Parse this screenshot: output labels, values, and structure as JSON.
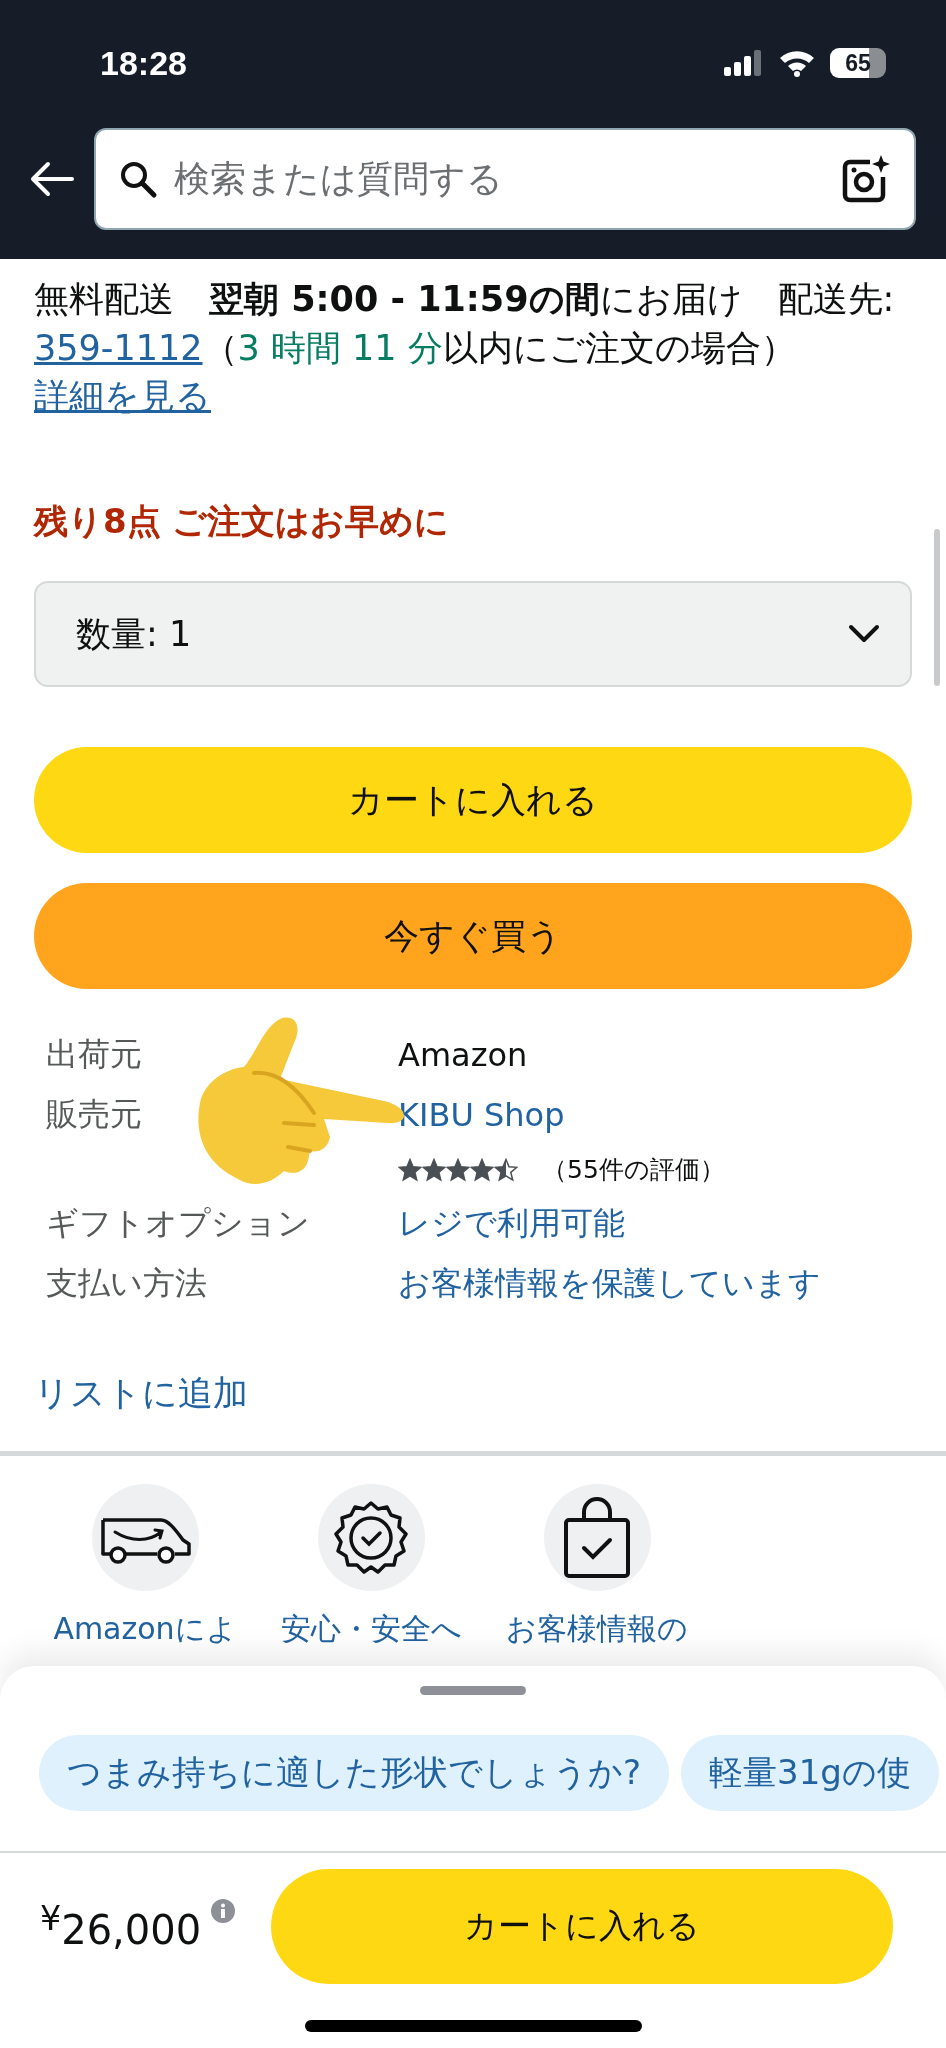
{
  "status_bar": {
    "time": "18:28",
    "battery": "65"
  },
  "search": {
    "placeholder": "検索または質問する"
  },
  "delivery": [
    {
      "kind": "text",
      "text": "無料配送　"
    },
    {
      "kind": "bold",
      "text": "翌朝 5:00 - 11:59の間"
    },
    {
      "kind": "text",
      "text": "にお届け　配送先: "
    },
    {
      "kind": "link",
      "text": "359-1112"
    },
    {
      "kind": "text",
      "text": "（"
    },
    {
      "kind": "highlight",
      "text": "3 時間 11 分"
    },
    {
      "kind": "text",
      "text": "以内にご注文の場合）"
    }
  ],
  "details_link": "詳細を見る",
  "stock_warning": "残り8点 ご注文はお早めに",
  "quantity": {
    "label": "数量: 1"
  },
  "buttons": [
    {
      "label": "カートに入れる",
      "kind": "cart"
    },
    {
      "label": "今すぐ買う",
      "kind": "buy"
    }
  ],
  "details": [
    {
      "kind": "text",
      "label": "出荷元",
      "value": "Amazon"
    },
    {
      "kind": "link",
      "label": "販売元",
      "value": "KIBU Shop"
    },
    {
      "kind": "rating",
      "stars": 4.5,
      "value": "（55件の評価）"
    },
    {
      "kind": "link",
      "label": "ギフトオプション",
      "value": "レジで利用可能"
    },
    {
      "kind": "link",
      "label": "支払い方法",
      "value": "お客様情報を保護しています"
    }
  ],
  "add_to_list": "リストに追加",
  "features": [
    {
      "kind": "van",
      "label": "Amazonによ"
    },
    {
      "kind": "badge",
      "label": "安心・安全へ"
    },
    {
      "kind": "bag",
      "label": "お客様情報の"
    }
  ],
  "suggestions": [
    "つまみ持ちに適した形状でしょうか?",
    "軽量31gの使"
  ],
  "footer": {
    "price": "$^{¥}$26,000",
    "button": "カートに入れる"
  }
}
